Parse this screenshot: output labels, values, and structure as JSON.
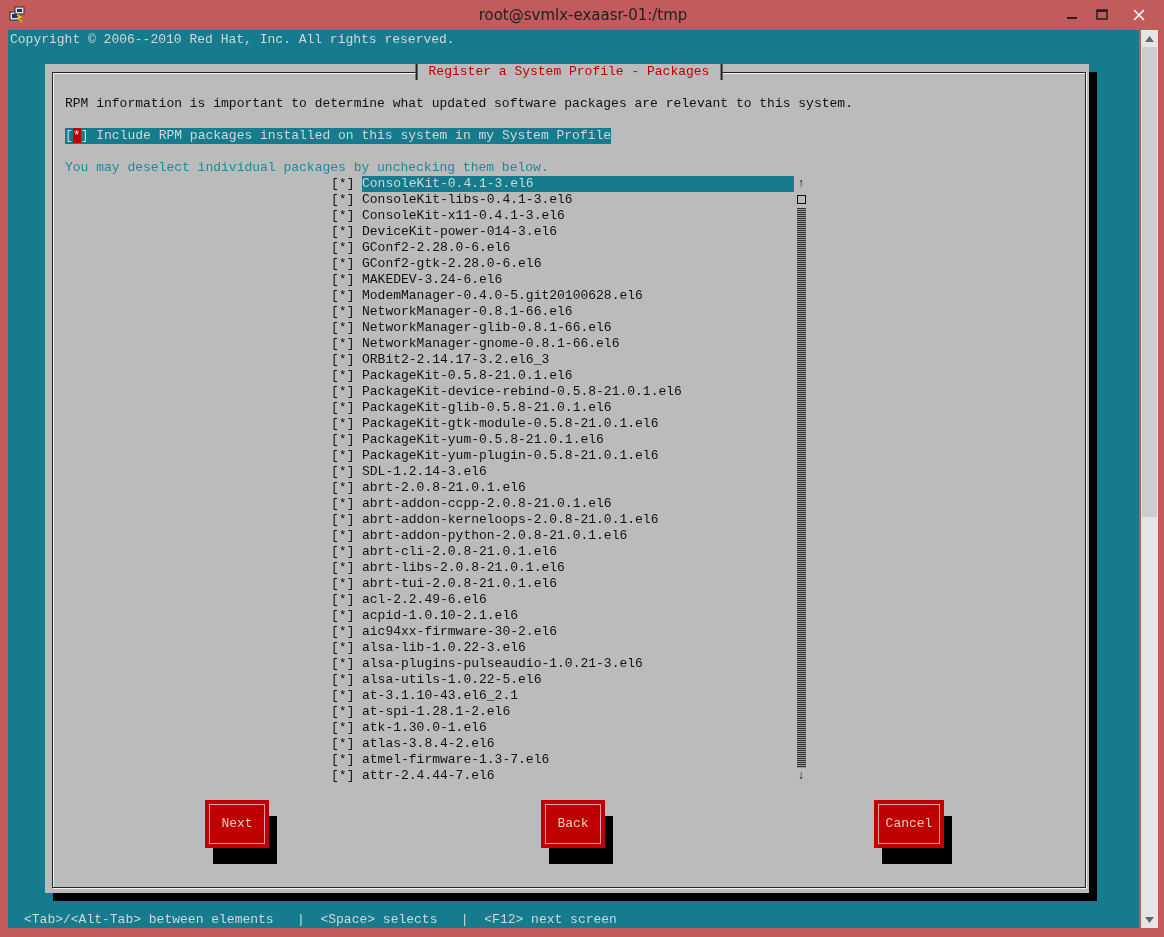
{
  "window": {
    "title": "root@svmlx-exaasr-01:/tmp"
  },
  "terminal": {
    "copyright": "Copyright © 2006--2010 Red Hat, Inc. All rights reserved.",
    "checkbox_glyphs": {
      "open": "[",
      "mark": "*",
      "close": "]"
    },
    "dialog": {
      "title": "Register a System Profile - Packages",
      "intro": "RPM information is important to determine what updated software packages are relevant to this system.",
      "include_option": {
        "label": "Include RPM packages installed on this system in my System Profile",
        "checked": true,
        "focused": true
      },
      "hint": "You may deselect individual packages by unchecking them below.",
      "packages": [
        {
          "name": "ConsoleKit-0.4.1-3.el6",
          "checked": true,
          "selected": true
        },
        {
          "name": "ConsoleKit-libs-0.4.1-3.el6",
          "checked": true,
          "selected": false
        },
        {
          "name": "ConsoleKit-x11-0.4.1-3.el6",
          "checked": true,
          "selected": false
        },
        {
          "name": "DeviceKit-power-014-3.el6",
          "checked": true,
          "selected": false
        },
        {
          "name": "GConf2-2.28.0-6.el6",
          "checked": true,
          "selected": false
        },
        {
          "name": "GConf2-gtk-2.28.0-6.el6",
          "checked": true,
          "selected": false
        },
        {
          "name": "MAKEDEV-3.24-6.el6",
          "checked": true,
          "selected": false
        },
        {
          "name": "ModemManager-0.4.0-5.git20100628.el6",
          "checked": true,
          "selected": false
        },
        {
          "name": "NetworkManager-0.8.1-66.el6",
          "checked": true,
          "selected": false
        },
        {
          "name": "NetworkManager-glib-0.8.1-66.el6",
          "checked": true,
          "selected": false
        },
        {
          "name": "NetworkManager-gnome-0.8.1-66.el6",
          "checked": true,
          "selected": false
        },
        {
          "name": "ORBit2-2.14.17-3.2.el6_3",
          "checked": true,
          "selected": false
        },
        {
          "name": "PackageKit-0.5.8-21.0.1.el6",
          "checked": true,
          "selected": false
        },
        {
          "name": "PackageKit-device-rebind-0.5.8-21.0.1.el6",
          "checked": true,
          "selected": false
        },
        {
          "name": "PackageKit-glib-0.5.8-21.0.1.el6",
          "checked": true,
          "selected": false
        },
        {
          "name": "PackageKit-gtk-module-0.5.8-21.0.1.el6",
          "checked": true,
          "selected": false
        },
        {
          "name": "PackageKit-yum-0.5.8-21.0.1.el6",
          "checked": true,
          "selected": false
        },
        {
          "name": "PackageKit-yum-plugin-0.5.8-21.0.1.el6",
          "checked": true,
          "selected": false
        },
        {
          "name": "SDL-1.2.14-3.el6",
          "checked": true,
          "selected": false
        },
        {
          "name": "abrt-2.0.8-21.0.1.el6",
          "checked": true,
          "selected": false
        },
        {
          "name": "abrt-addon-ccpp-2.0.8-21.0.1.el6",
          "checked": true,
          "selected": false
        },
        {
          "name": "abrt-addon-kerneloops-2.0.8-21.0.1.el6",
          "checked": true,
          "selected": false
        },
        {
          "name": "abrt-addon-python-2.0.8-21.0.1.el6",
          "checked": true,
          "selected": false
        },
        {
          "name": "abrt-cli-2.0.8-21.0.1.el6",
          "checked": true,
          "selected": false
        },
        {
          "name": "abrt-libs-2.0.8-21.0.1.el6",
          "checked": true,
          "selected": false
        },
        {
          "name": "abrt-tui-2.0.8-21.0.1.el6",
          "checked": true,
          "selected": false
        },
        {
          "name": "acl-2.2.49-6.el6",
          "checked": true,
          "selected": false
        },
        {
          "name": "acpid-1.0.10-2.1.el6",
          "checked": true,
          "selected": false
        },
        {
          "name": "aic94xx-firmware-30-2.el6",
          "checked": true,
          "selected": false
        },
        {
          "name": "alsa-lib-1.0.22-3.el6",
          "checked": true,
          "selected": false
        },
        {
          "name": "alsa-plugins-pulseaudio-1.0.21-3.el6",
          "checked": true,
          "selected": false
        },
        {
          "name": "alsa-utils-1.0.22-5.el6",
          "checked": true,
          "selected": false
        },
        {
          "name": "at-3.1.10-43.el6_2.1",
          "checked": true,
          "selected": false
        },
        {
          "name": "at-spi-1.28.1-2.el6",
          "checked": true,
          "selected": false
        },
        {
          "name": "atk-1.30.0-1.el6",
          "checked": true,
          "selected": false
        },
        {
          "name": "atlas-3.8.4-2.el6",
          "checked": true,
          "selected": false
        },
        {
          "name": "atmel-firmware-1.3-7.el6",
          "checked": true,
          "selected": false
        },
        {
          "name": "attr-2.4.44-7.el6",
          "checked": true,
          "selected": false
        }
      ],
      "list_scroll": {
        "up": "↑",
        "down": "↓"
      },
      "buttons": [
        {
          "label": "Next"
        },
        {
          "label": "Back"
        },
        {
          "label": "Cancel"
        }
      ]
    },
    "status_bar": "<Tab>/<Alt-Tab> between elements   |  <Space> selects   |  <F12> next screen"
  }
}
